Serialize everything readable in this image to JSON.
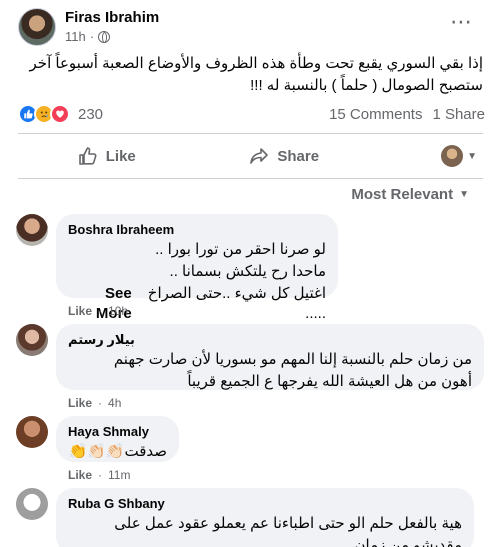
{
  "post": {
    "author": "Firas Ibrahim",
    "time": "11h",
    "more_icon": "⋯",
    "text": "إذا بقي السوري يقبع تحت وطأة هذه الظروف والأوضاع الصعبة أسبوعاً آخر ستصبح الصومال ( حلماً ) بالنسبة له !!!"
  },
  "reactions": {
    "icons": [
      "like-reaction",
      "sad-reaction",
      "love-reaction"
    ],
    "count": "230",
    "comments": "15 Comments",
    "shares": "1 Share"
  },
  "actions": {
    "like": "Like",
    "share": "Share"
  },
  "sort": {
    "label": "Most Relevant",
    "caret": "▼"
  },
  "comments": [
    {
      "name": "Boshra Ibraheem",
      "lines": [
        "لو صرنا احقر من تورا بورا ..",
        "ماحدا رح يلتكش بسمانا ..",
        "اغتيل كل شيء ..حتى الصراخ ....."
      ],
      "see_more": "See More",
      "like": "Like",
      "time": "10h"
    },
    {
      "name": "بيلار رستم",
      "lines": [
        "من زمان حلم بالنسبة إلنا المهم مو بسوريا لأن صارت جهنم",
        "أهون من هل العيشة الله يفرجها ع الجميع قريباً"
      ],
      "like": "Like",
      "time": "4h"
    },
    {
      "name": "Haya Shmaly",
      "lines": [
        "صدقت👏🏻👏🏻👏"
      ],
      "like": "Like",
      "time": "11m"
    },
    {
      "name": "Ruba G Shbany",
      "lines": [
        "هية بالفعل حلم الو حتى اطباءنا عم يعملو عقود عمل على",
        "مقديشو من زمان"
      ]
    }
  ]
}
